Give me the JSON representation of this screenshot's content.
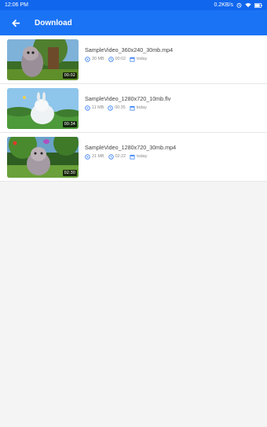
{
  "status": {
    "time": "12:06 PM",
    "network": "0.2KB/s"
  },
  "header": {
    "title": "Download"
  },
  "videos": [
    {
      "name": "SampleVideo_360x240_30mb.mp4",
      "size": "30 MB",
      "duration": "00:02",
      "date": "today",
      "badge": "00:02"
    },
    {
      "name": "SampleVideo_1280x720_10mb.flv",
      "size": "11 MB",
      "duration": "00:35",
      "date": "today",
      "badge": "00:34"
    },
    {
      "name": "SampleVideo_1280x720_30mb.mp4",
      "size": "21 MB",
      "duration": "02:22",
      "date": "today",
      "badge": "02:30"
    }
  ]
}
